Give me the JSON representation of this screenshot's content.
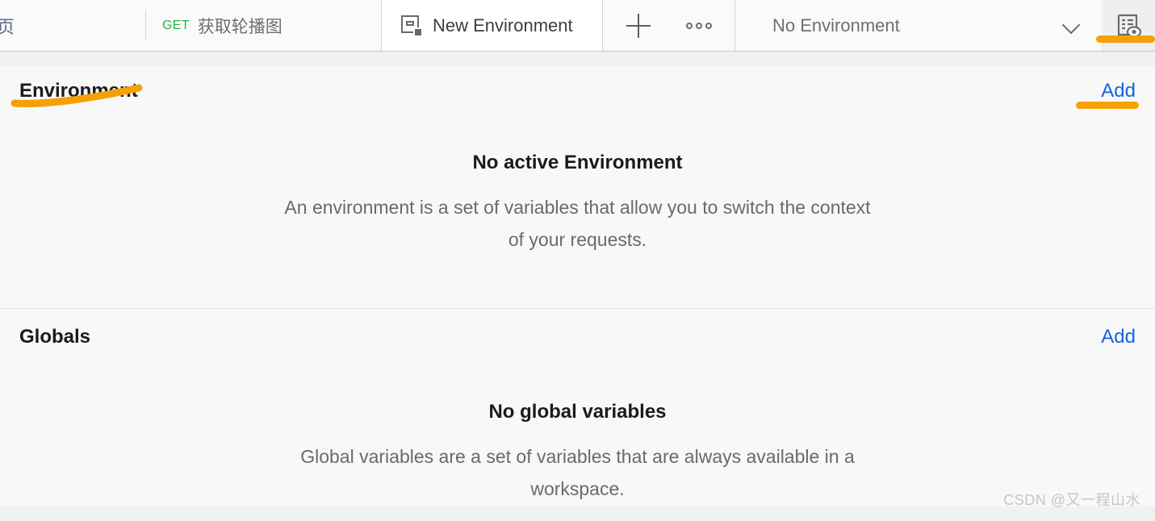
{
  "tabbar": {
    "home_tab_label": "页",
    "request_tab": {
      "method": "GET",
      "label": "获取轮播图"
    },
    "active_tab": {
      "label": "New Environment",
      "icon": "environment-icon"
    },
    "new_tab_icon": "plus-icon",
    "more_actions_icon": "ellipsis-icon",
    "environment_selector": {
      "value": "No Environment",
      "chevron_icon": "chevron-down-icon"
    },
    "quick_look_icon": "environment-quick-look-icon"
  },
  "environment_section": {
    "title": "Environment",
    "add_label": "Add",
    "empty_title": "No active Environment",
    "empty_desc": "An environment is a set of variables that allow you to switch the context of your requests."
  },
  "globals_section": {
    "title": "Globals",
    "add_label": "Add",
    "empty_title": "No global variables",
    "empty_desc": "Global variables are a set of variables that are always available in a workspace."
  },
  "watermark": "CSDN @又一程山水",
  "colors": {
    "annotation_orange": "#f5a106",
    "link_blue": "#1464e0",
    "method_green": "#2cb14a",
    "panel_bg": "#f8f8f8"
  }
}
